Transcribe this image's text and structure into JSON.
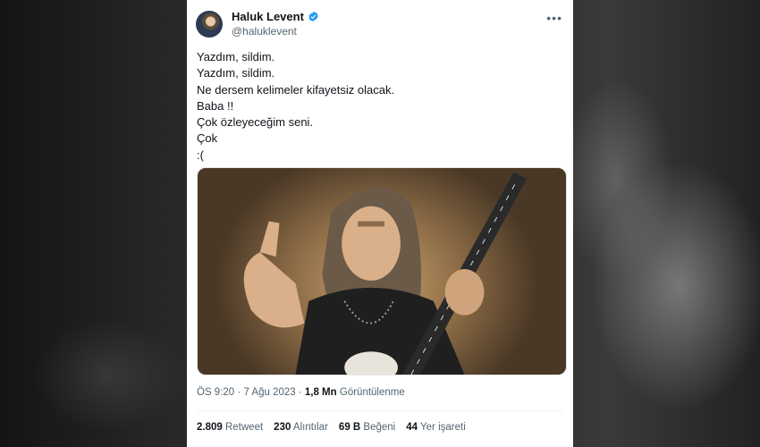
{
  "author": {
    "name": "Haluk Levent",
    "handle": "@haluklevent",
    "verified": true
  },
  "tweet": {
    "lines": [
      "Yazdım, sildim.",
      "Yazdım, sildim.",
      "Ne dersem kelimeler kifayetsiz olacak.",
      "Baba !!",
      "Çok özleyeceğim seni.",
      "Çok",
      ":("
    ]
  },
  "meta": {
    "time": "ÖS 9:20",
    "date": "7 Ağu 2023",
    "views": "1,8 Mn",
    "views_label": "Görüntülenme"
  },
  "stats": {
    "retweets": "2.809",
    "retweets_label": "Retweet",
    "quotes": "230",
    "quotes_label": "Alıntılar",
    "likes": "69 B",
    "likes_label": "Beğeni",
    "bookmarks": "44",
    "bookmarks_label": "Yer işareti"
  },
  "icons": {
    "more": "more-options-icon",
    "verified": "verified-badge-icon"
  },
  "colors": {
    "verified_blue": "#1d9bf0",
    "text_primary": "#0f1419",
    "text_secondary": "#536471"
  }
}
